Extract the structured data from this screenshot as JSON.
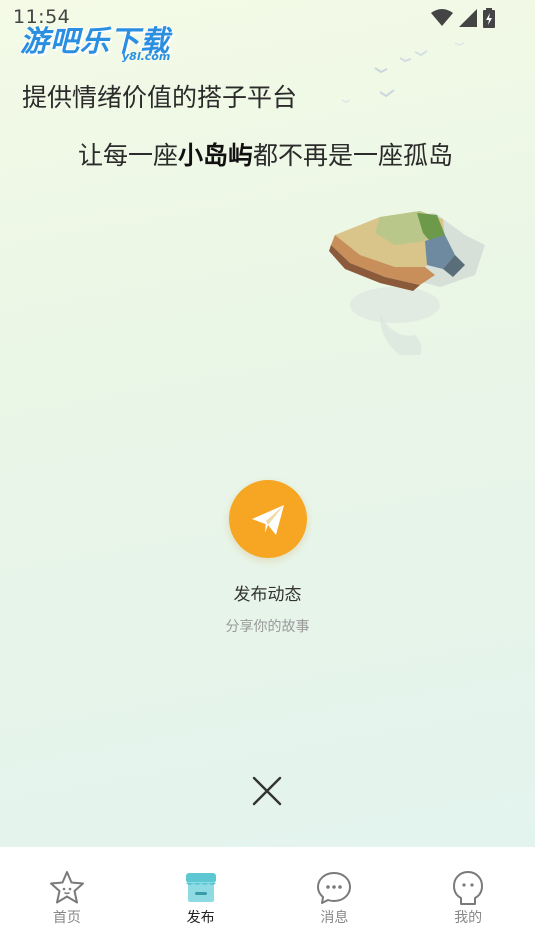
{
  "status_bar": {
    "time": "11:54"
  },
  "watermark": {
    "main": "游吧乐下载",
    "sub": "y8l.com"
  },
  "headline": {
    "line1": "提供情绪价值的搭子平台",
    "line2_prefix": "让每一座",
    "line2_highlight": "小岛屿",
    "line2_suffix": "都不再是一座孤岛"
  },
  "publish": {
    "label": "发布动态",
    "subtitle": "分享你的故事",
    "icon": "paper-plane-icon",
    "color": "#f6a623"
  },
  "close": {
    "icon": "close-icon"
  },
  "tabbar": {
    "tabs": [
      {
        "label": "首页",
        "icon": "star-icon",
        "active": false
      },
      {
        "label": "发布",
        "icon": "shop-icon",
        "active": true
      },
      {
        "label": "消息",
        "icon": "chat-bubble-icon",
        "active": false
      },
      {
        "label": "我的",
        "icon": "face-icon",
        "active": false
      }
    ]
  }
}
